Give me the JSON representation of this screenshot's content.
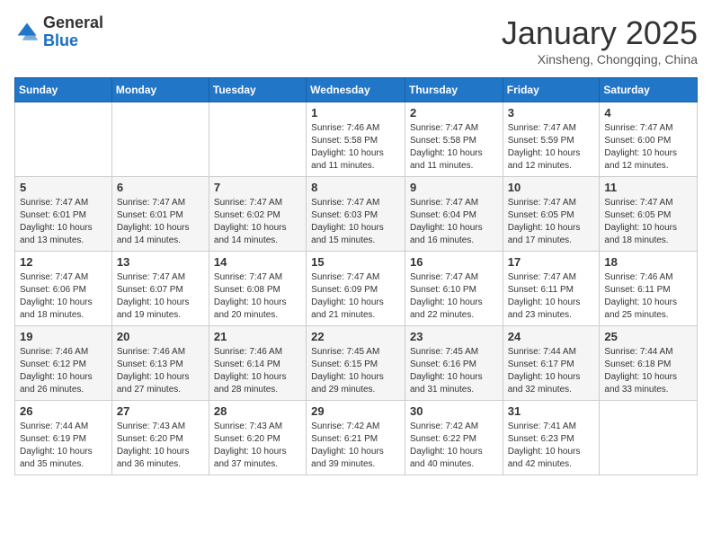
{
  "header": {
    "logo_general": "General",
    "logo_blue": "Blue",
    "title": "January 2025",
    "subtitle": "Xinsheng, Chongqing, China"
  },
  "days_of_week": [
    "Sunday",
    "Monday",
    "Tuesday",
    "Wednesday",
    "Thursday",
    "Friday",
    "Saturday"
  ],
  "weeks": [
    [
      {
        "num": "",
        "info": ""
      },
      {
        "num": "",
        "info": ""
      },
      {
        "num": "",
        "info": ""
      },
      {
        "num": "1",
        "info": "Sunrise: 7:46 AM\nSunset: 5:58 PM\nDaylight: 10 hours and 11 minutes."
      },
      {
        "num": "2",
        "info": "Sunrise: 7:47 AM\nSunset: 5:58 PM\nDaylight: 10 hours and 11 minutes."
      },
      {
        "num": "3",
        "info": "Sunrise: 7:47 AM\nSunset: 5:59 PM\nDaylight: 10 hours and 12 minutes."
      },
      {
        "num": "4",
        "info": "Sunrise: 7:47 AM\nSunset: 6:00 PM\nDaylight: 10 hours and 12 minutes."
      }
    ],
    [
      {
        "num": "5",
        "info": "Sunrise: 7:47 AM\nSunset: 6:01 PM\nDaylight: 10 hours and 13 minutes."
      },
      {
        "num": "6",
        "info": "Sunrise: 7:47 AM\nSunset: 6:01 PM\nDaylight: 10 hours and 14 minutes."
      },
      {
        "num": "7",
        "info": "Sunrise: 7:47 AM\nSunset: 6:02 PM\nDaylight: 10 hours and 14 minutes."
      },
      {
        "num": "8",
        "info": "Sunrise: 7:47 AM\nSunset: 6:03 PM\nDaylight: 10 hours and 15 minutes."
      },
      {
        "num": "9",
        "info": "Sunrise: 7:47 AM\nSunset: 6:04 PM\nDaylight: 10 hours and 16 minutes."
      },
      {
        "num": "10",
        "info": "Sunrise: 7:47 AM\nSunset: 6:05 PM\nDaylight: 10 hours and 17 minutes."
      },
      {
        "num": "11",
        "info": "Sunrise: 7:47 AM\nSunset: 6:05 PM\nDaylight: 10 hours and 18 minutes."
      }
    ],
    [
      {
        "num": "12",
        "info": "Sunrise: 7:47 AM\nSunset: 6:06 PM\nDaylight: 10 hours and 18 minutes."
      },
      {
        "num": "13",
        "info": "Sunrise: 7:47 AM\nSunset: 6:07 PM\nDaylight: 10 hours and 19 minutes."
      },
      {
        "num": "14",
        "info": "Sunrise: 7:47 AM\nSunset: 6:08 PM\nDaylight: 10 hours and 20 minutes."
      },
      {
        "num": "15",
        "info": "Sunrise: 7:47 AM\nSunset: 6:09 PM\nDaylight: 10 hours and 21 minutes."
      },
      {
        "num": "16",
        "info": "Sunrise: 7:47 AM\nSunset: 6:10 PM\nDaylight: 10 hours and 22 minutes."
      },
      {
        "num": "17",
        "info": "Sunrise: 7:47 AM\nSunset: 6:11 PM\nDaylight: 10 hours and 23 minutes."
      },
      {
        "num": "18",
        "info": "Sunrise: 7:46 AM\nSunset: 6:11 PM\nDaylight: 10 hours and 25 minutes."
      }
    ],
    [
      {
        "num": "19",
        "info": "Sunrise: 7:46 AM\nSunset: 6:12 PM\nDaylight: 10 hours and 26 minutes."
      },
      {
        "num": "20",
        "info": "Sunrise: 7:46 AM\nSunset: 6:13 PM\nDaylight: 10 hours and 27 minutes."
      },
      {
        "num": "21",
        "info": "Sunrise: 7:46 AM\nSunset: 6:14 PM\nDaylight: 10 hours and 28 minutes."
      },
      {
        "num": "22",
        "info": "Sunrise: 7:45 AM\nSunset: 6:15 PM\nDaylight: 10 hours and 29 minutes."
      },
      {
        "num": "23",
        "info": "Sunrise: 7:45 AM\nSunset: 6:16 PM\nDaylight: 10 hours and 31 minutes."
      },
      {
        "num": "24",
        "info": "Sunrise: 7:44 AM\nSunset: 6:17 PM\nDaylight: 10 hours and 32 minutes."
      },
      {
        "num": "25",
        "info": "Sunrise: 7:44 AM\nSunset: 6:18 PM\nDaylight: 10 hours and 33 minutes."
      }
    ],
    [
      {
        "num": "26",
        "info": "Sunrise: 7:44 AM\nSunset: 6:19 PM\nDaylight: 10 hours and 35 minutes."
      },
      {
        "num": "27",
        "info": "Sunrise: 7:43 AM\nSunset: 6:20 PM\nDaylight: 10 hours and 36 minutes."
      },
      {
        "num": "28",
        "info": "Sunrise: 7:43 AM\nSunset: 6:20 PM\nDaylight: 10 hours and 37 minutes."
      },
      {
        "num": "29",
        "info": "Sunrise: 7:42 AM\nSunset: 6:21 PM\nDaylight: 10 hours and 39 minutes."
      },
      {
        "num": "30",
        "info": "Sunrise: 7:42 AM\nSunset: 6:22 PM\nDaylight: 10 hours and 40 minutes."
      },
      {
        "num": "31",
        "info": "Sunrise: 7:41 AM\nSunset: 6:23 PM\nDaylight: 10 hours and 42 minutes."
      },
      {
        "num": "",
        "info": ""
      }
    ]
  ]
}
